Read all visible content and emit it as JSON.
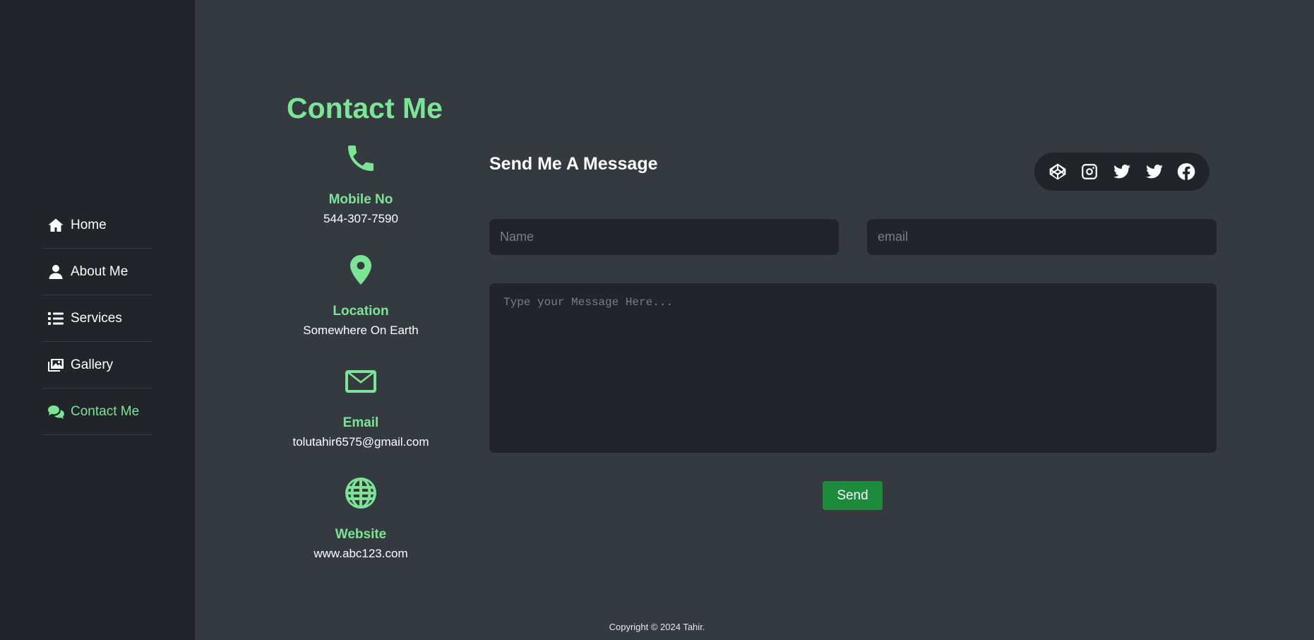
{
  "sidebar": {
    "items": [
      {
        "label": "Home",
        "icon": "home-icon"
      },
      {
        "label": "About Me",
        "icon": "user-icon"
      },
      {
        "label": "Services",
        "icon": "list-icon"
      },
      {
        "label": "Gallery",
        "icon": "images-icon"
      },
      {
        "label": "Contact Me",
        "icon": "comments-icon",
        "active": true
      }
    ]
  },
  "page": {
    "title": "Contact Me"
  },
  "info": [
    {
      "label": "Mobile No",
      "value": "544-307-7590",
      "icon": "phone-icon"
    },
    {
      "label": "Location",
      "value": "Somewhere On Earth",
      "icon": "location-pin-icon"
    },
    {
      "label": "Email",
      "value": "tolutahir6575@gmail.com",
      "icon": "envelope-icon"
    },
    {
      "label": "Website",
      "value": "www.abc123.com",
      "icon": "globe-icon"
    }
  ],
  "form": {
    "title": "Send Me A Message",
    "name_placeholder": "Name",
    "email_placeholder": "email",
    "message_placeholder": "Type your Message Here...",
    "send_label": "Send"
  },
  "social": [
    "codepen-icon",
    "instagram-icon",
    "twitter-icon",
    "twitter-icon",
    "facebook-icon"
  ],
  "footer": {
    "text": "Copyright © 2024 Tahir."
  },
  "colors": {
    "accent": "#7be495",
    "sidebar_bg": "#212529",
    "main_bg": "#343a40",
    "send_button": "#1e8a3c"
  }
}
